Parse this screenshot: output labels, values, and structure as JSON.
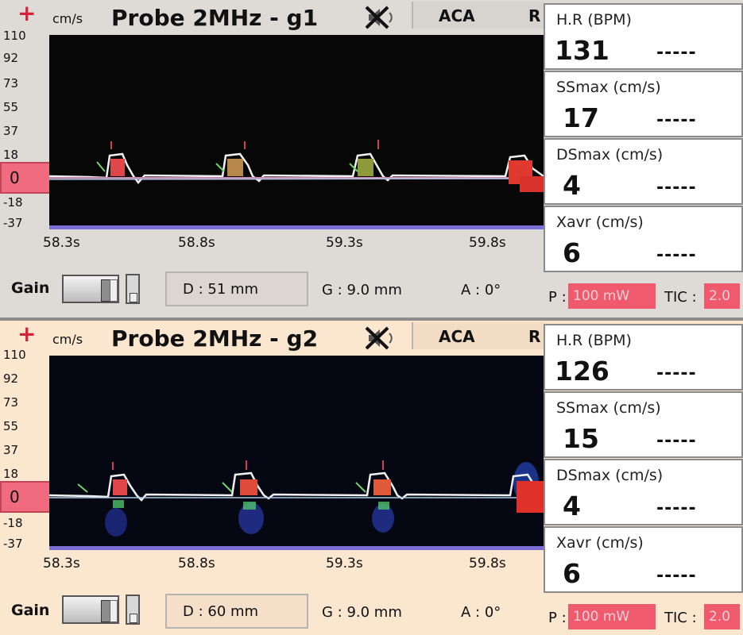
{
  "colors": {
    "accent_red": "#d2233a",
    "zero_marker": "#ef6b7d",
    "power_badge": "#ef5a6e",
    "baseline": "#7a6dd6"
  },
  "panels": [
    {
      "plus_icon": "plus-icon",
      "unit": "cm/s",
      "title": "Probe 2MHz - g1",
      "mute_icon": "mute-icon",
      "tabs": [
        "ACA",
        "R"
      ],
      "y_ticks": [
        "110",
        "92",
        "73",
        "55",
        "37",
        "18",
        "-18",
        "-37"
      ],
      "zero_label": "0",
      "x_ticks": [
        "58.3s",
        "58.8s",
        "59.3s",
        "59.8s"
      ],
      "gain_label": "Gain",
      "depth": "D : 51 mm",
      "gate": "G : 9.0 mm",
      "angle": "A : 0°",
      "metrics": [
        {
          "label": "H.R (BPM)",
          "value": "131",
          "dash": "-----"
        },
        {
          "label": "SSmax (cm/s)",
          "value": "17",
          "dash": "-----"
        },
        {
          "label": "DSmax (cm/s)",
          "value": "4",
          "dash": "-----"
        },
        {
          "label": "Xavr (cm/s)",
          "value": "6",
          "dash": "-----"
        }
      ],
      "power_label": "P :",
      "power_value": "100 mW",
      "tic_label": "TIC :",
      "tic_value": "2.0"
    },
    {
      "plus_icon": "plus-icon",
      "unit": "cm/s",
      "title": "Probe 2MHz - g2",
      "mute_icon": "mute-icon",
      "tabs": [
        "ACA",
        "R"
      ],
      "y_ticks": [
        "110",
        "92",
        "73",
        "55",
        "37",
        "18",
        "-18",
        "-37"
      ],
      "zero_label": "0",
      "x_ticks": [
        "58.3s",
        "58.8s",
        "59.3s",
        "59.8s"
      ],
      "gain_label": "Gain",
      "depth": "D : 60 mm",
      "gate": "G : 9.0 mm",
      "angle": "A : 0°",
      "metrics": [
        {
          "label": "H.R (BPM)",
          "value": "126",
          "dash": "-----"
        },
        {
          "label": "SSmax (cm/s)",
          "value": "15",
          "dash": "-----"
        },
        {
          "label": "DSmax (cm/s)",
          "value": "4",
          "dash": "-----"
        },
        {
          "label": "Xavr (cm/s)",
          "value": "6",
          "dash": "-----"
        }
      ],
      "power_label": "P :",
      "power_value": "100 mW",
      "tic_label": "TIC :",
      "tic_value": "2.0"
    }
  ]
}
